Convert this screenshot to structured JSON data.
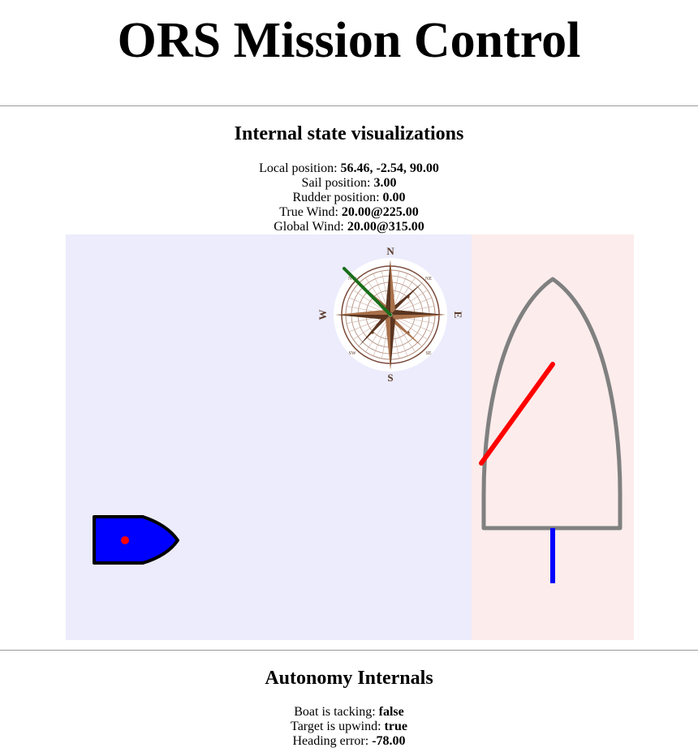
{
  "title": "ORS Mission Control",
  "state_section": {
    "heading": "Internal state visualizations",
    "rows": [
      {
        "label": "Local position:",
        "value": "56.46, -2.54, 90.00"
      },
      {
        "label": "Sail position:",
        "value": "3.00"
      },
      {
        "label": "Rudder position:",
        "value": "0.00"
      },
      {
        "label": "True Wind:",
        "value": "20.00@225.00"
      },
      {
        "label": "Global Wind:",
        "value": "20.00@315.00"
      }
    ]
  },
  "compass": {
    "north": "N",
    "south": "S",
    "east": "E",
    "west": "W",
    "ne": "NE",
    "se": "SE",
    "sw": "SW",
    "nw": "NW"
  },
  "colors": {
    "map_bg": "#ececfc",
    "boat_bg": "#fcecec",
    "boat_fill": "#0000ff",
    "sail": "#ff0000",
    "rudder": "#0000ff",
    "wind_arrow": "#1a6e1a",
    "hull_outline": "#808080"
  },
  "autonomy_section": {
    "heading": "Autonomy Internals",
    "rows": [
      {
        "label": "Boat is tacking:",
        "value": "false"
      },
      {
        "label": "Target is upwind:",
        "value": "true"
      },
      {
        "label": "Heading error:",
        "value": "-78.00"
      }
    ]
  }
}
